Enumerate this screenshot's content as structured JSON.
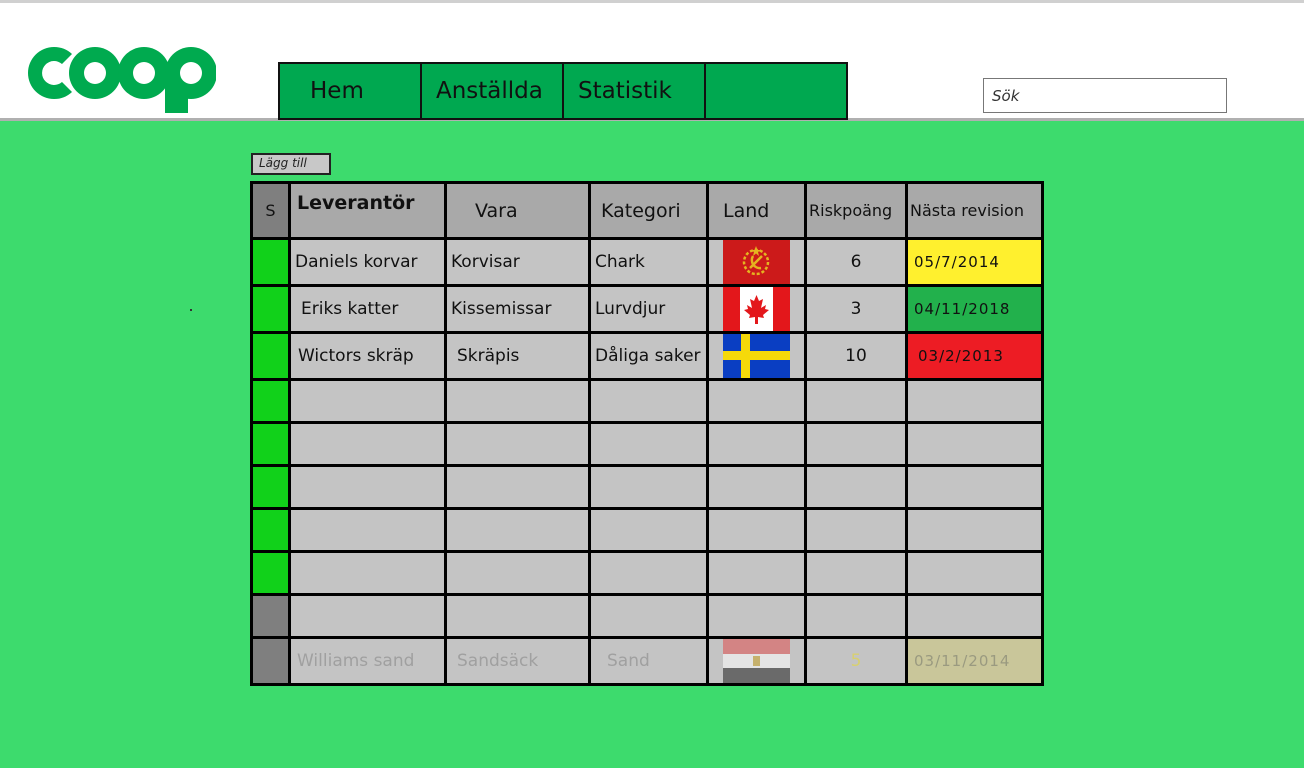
{
  "header": {
    "logo_text": "coop",
    "nav": [
      "Hem",
      "Anställda",
      "Statistik",
      ""
    ],
    "search_value": "Sök"
  },
  "toolbar": {
    "add_label": "Lägg till"
  },
  "table": {
    "columns": [
      "S",
      "Leverantör",
      "Vara",
      "Kategori",
      "Land",
      "Riskpoäng",
      "Nästa revision"
    ],
    "rows": [
      {
        "status": "green",
        "supplier": "Daniels korvar",
        "item": "Korvisar",
        "category": "Chark",
        "flag": "soviet-flag-icon",
        "risk": "6",
        "risk_color": "#f5e02a",
        "revision": "05/7/2014",
        "revision_color": "#fff02e"
      },
      {
        "status": "green",
        "supplier": "Eriks katter",
        "item": "Kissemissar",
        "category": "Lurvdjur",
        "flag": "canada-flag-icon",
        "risk": "3",
        "risk_color": "#1fa84a",
        "revision": "04/11/2018",
        "revision_color": "#22b14c"
      },
      {
        "status": "green",
        "supplier": "Wictors skräp",
        "item": "Skräpis",
        "category": "Dåliga saker",
        "flag": "sweden-flag-icon",
        "risk": "10",
        "risk_color": "#ee2222",
        "revision": "03/2/2013",
        "revision_color": "#ed1c24"
      },
      {
        "status": "green"
      },
      {
        "status": "green"
      },
      {
        "status": "green"
      },
      {
        "status": "green"
      },
      {
        "status": "green"
      },
      {
        "status": "gray"
      },
      {
        "status": "gray",
        "supplier": "Williams sand",
        "item": "Sandsäck",
        "category": "Sand",
        "flag": "egypt-flag-icon",
        "risk": "5",
        "revision": "03/11/2014"
      }
    ]
  },
  "colors": {
    "background": "#3ddb6d",
    "nav_green": "#00a850",
    "logo_green": "#00aa4f",
    "status_green": "#11d11a"
  }
}
